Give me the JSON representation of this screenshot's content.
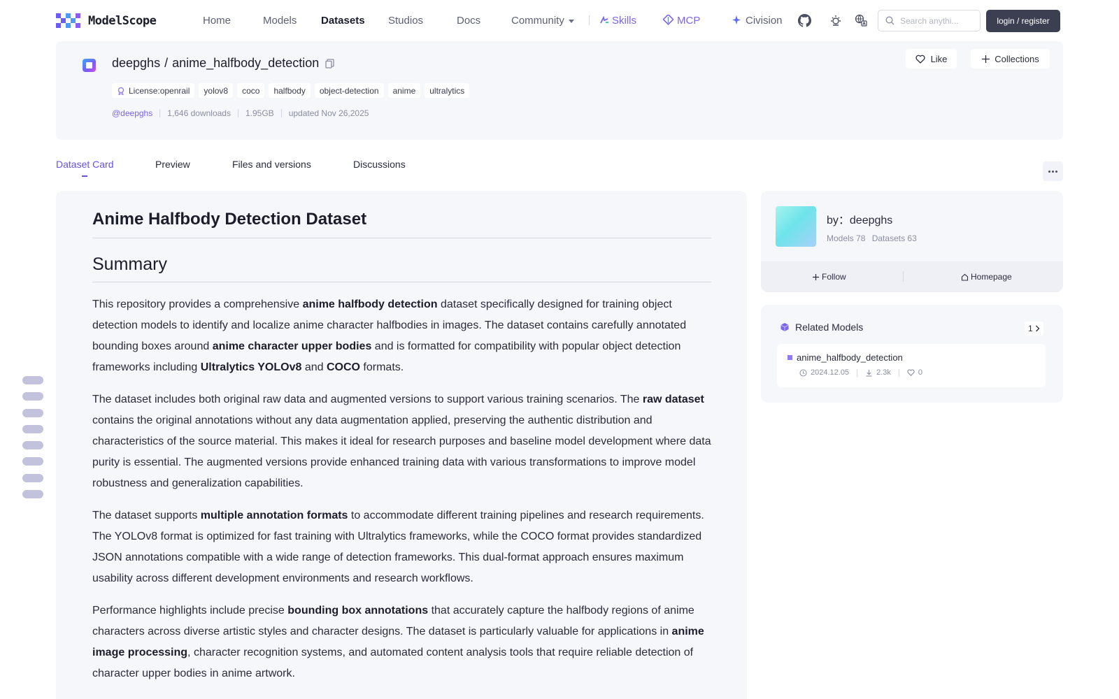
{
  "brand": {
    "name": "ModelScope"
  },
  "nav": {
    "home": "Home",
    "models": "Models",
    "datasets": "Datasets",
    "studios": "Studios",
    "docs": "Docs",
    "community": "Community",
    "skills": "Skills",
    "mcp": "MCP",
    "civision": "Civision"
  },
  "search": {
    "placeholder": "Search anythi..."
  },
  "auth": {
    "login_label": "login / register"
  },
  "repo": {
    "owner": "deepghs",
    "separator": "/",
    "name": "anime_halfbody_detection",
    "license_label": "License:openrail",
    "tags": [
      "yolov8",
      "coco",
      "halfbody",
      "object-detection",
      "anime",
      "ultralytics"
    ],
    "author_handle": "@deepghs",
    "downloads": "1,646 downloads",
    "size": "1.95GB",
    "updated": "updated Nov 26,2025",
    "like_label": "Like",
    "collections_label": "Collections"
  },
  "tabs": {
    "dataset_card": "Dataset Card",
    "preview": "Preview",
    "files": "Files and versions",
    "discussions": "Discussions"
  },
  "doc": {
    "title": "Anime Halfbody Detection Dataset",
    "section": "Summary",
    "p1": {
      "a": "This repository provides a comprehensive ",
      "b1": "anime halfbody detection",
      "c": " dataset specifically designed for training object detection models to identify and localize anime character halfbodies in images. The dataset contains carefully annotated bounding boxes around ",
      "b2": "anime character upper bodies",
      "d": " and is formatted for compatibility with popular object detection frameworks including ",
      "b3": "Ultralytics YOLOv8",
      "e": " and ",
      "b4": "COCO",
      "f": " formats."
    },
    "p2": {
      "a": "The dataset includes both original raw data and augmented versions to support various training scenarios. The ",
      "b1": "raw dataset",
      "c": " contains the original annotations without any data augmentation applied, preserving the authentic distribution and characteristics of the source material. This makes it ideal for research purposes and baseline model development where data purity is essential. The augmented versions provide enhanced training data with various transformations to improve model robustness and generalization capabilities."
    },
    "p3": {
      "a": "The dataset supports ",
      "b1": "multiple annotation formats",
      "c": " to accommodate different training pipelines and research requirements. The YOLOv8 format is optimized for fast training with Ultralytics frameworks, while the COCO format provides standardized JSON annotations compatible with a wide range of detection frameworks. This dual-format approach ensures maximum usability across different development environments and research workflows."
    },
    "p4": {
      "a": "Performance highlights include precise ",
      "b1": "bounding box annotations",
      "c": " that accurately capture the halfbody regions of anime characters across diverse artistic styles and character designs. The dataset is particularly valuable for applications in ",
      "b2": "anime image processing",
      "d": ", character recognition systems, and automated content analysis tools that require reliable detection of character upper bodies in anime artwork."
    }
  },
  "author_card": {
    "by_label": "by：deepghs",
    "models": "Models 78",
    "datasets": "Datasets 63",
    "follow_label": "Follow",
    "homepage_label": "Homepage"
  },
  "related": {
    "title": "Related Models",
    "count": "1",
    "items": [
      {
        "name": "anime_halfbody_detection",
        "date": "2024.12.05",
        "downloads": "2.3k",
        "likes": "0"
      }
    ]
  },
  "colors": {
    "accent": "#6651e8",
    "brand": "#6b5cf6",
    "card_bg": "#f6f7fb",
    "login_bg": "#3b3f51"
  },
  "icons": [
    "github-icon",
    "theme-sun-icon",
    "language-icon",
    "search-icon",
    "heart-icon",
    "plus-icon",
    "copy-icon",
    "clock-icon",
    "download-icon",
    "chevron-right-icon",
    "home-icon",
    "more-icon"
  ]
}
